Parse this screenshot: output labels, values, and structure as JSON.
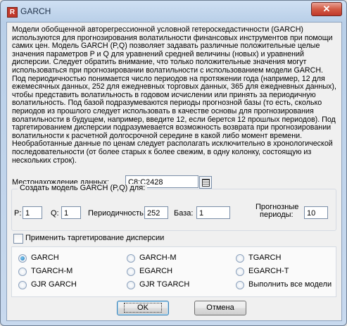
{
  "window": {
    "title": "GARCH",
    "app_icon": "R",
    "close_symbol": "✕"
  },
  "description": "Модели обобщенной авторегрессионной условной гетероскедастичности (GARCH) используются для прогнозирования волатильности финансовых инструментов при помощи самих цен. Модель GARCH (P,Q) позволяет задавать различные положительные целые значения параметров P и Q для уравнений средней величины (новых) и уравнений дисперсии. Следует обратить внимание, что только положительные значения могут использоваться при прогнозировании волатильности с использованием модели GARCH. Под периодичностью понимается число периодов на протяжении года (например, 12 для ежемесячных данных, 252 для ежедневных торговых данных, 365 для ежедневных данных), чтобы представить волатильность в годовом исчислении или принять за периодичную волатильность. Под базой подразумеваются периоды прогнозной базы (то есть, сколько периодов из прошлого следует использовать в качестве основы для прогнозирования волатильности в будущем, например, введите 12, если берется 12 прошлых периодов). Под таргетированием дисперсии подразумевается возможность возврата при прогнозировании волатильности к расчетной долгосрочной середине в какой либо момент времени. Необработанные данные по ценам следует располагать исключительно в хронологической последовательности (от более старых к более свежим, в одну колонку, состоящую из нескольких строк).",
  "data_location": {
    "label": "Местонахождение данных:",
    "value": "C8:C2428"
  },
  "params": {
    "group_title": "Создать модель GARCH (P,Q) для:",
    "p_label": "P:",
    "p_value": "1",
    "q_label": "Q:",
    "q_value": "1",
    "period_label": "Периодичность:",
    "period_value": "252",
    "base_label": "База:",
    "base_value": "1",
    "forecast_label_1": "Прогнозные",
    "forecast_label_2": "периоды:",
    "forecast_value": "10"
  },
  "variance_targeting": {
    "label": "Применить таргетирование дисперсии",
    "checked": false
  },
  "models": [
    {
      "label": "GARCH",
      "selected": true
    },
    {
      "label": "GARCH-M",
      "selected": false
    },
    {
      "label": "TGARCH",
      "selected": false
    },
    {
      "label": "TGARCH-M",
      "selected": false
    },
    {
      "label": "EGARCH",
      "selected": false
    },
    {
      "label": "EGARCH-T",
      "selected": false
    },
    {
      "label": "GJR GARCH",
      "selected": false
    },
    {
      "label": "GJR TGARCH",
      "selected": false
    },
    {
      "label": "Выполнить все модели",
      "selected": false
    }
  ],
  "buttons": {
    "ok": "OK",
    "cancel": "Отмена"
  }
}
